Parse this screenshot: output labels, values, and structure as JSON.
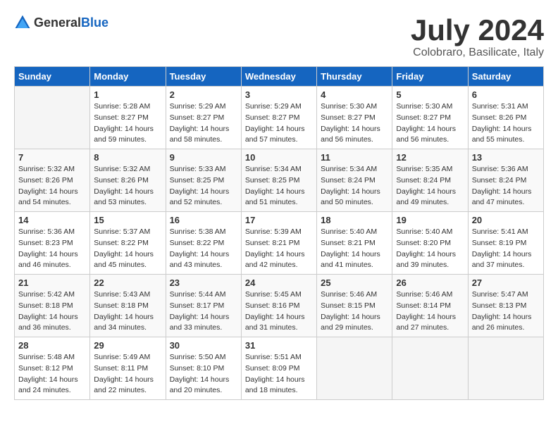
{
  "header": {
    "logo": {
      "text_general": "General",
      "text_blue": "Blue"
    },
    "title": "July 2024",
    "subtitle": "Colobraro, Basilicate, Italy"
  },
  "days_of_week": [
    "Sunday",
    "Monday",
    "Tuesday",
    "Wednesday",
    "Thursday",
    "Friday",
    "Saturday"
  ],
  "weeks": [
    [
      {
        "day": "",
        "info": ""
      },
      {
        "day": "1",
        "info": "Sunrise: 5:28 AM\nSunset: 8:27 PM\nDaylight: 14 hours\nand 59 minutes."
      },
      {
        "day": "2",
        "info": "Sunrise: 5:29 AM\nSunset: 8:27 PM\nDaylight: 14 hours\nand 58 minutes."
      },
      {
        "day": "3",
        "info": "Sunrise: 5:29 AM\nSunset: 8:27 PM\nDaylight: 14 hours\nand 57 minutes."
      },
      {
        "day": "4",
        "info": "Sunrise: 5:30 AM\nSunset: 8:27 PM\nDaylight: 14 hours\nand 56 minutes."
      },
      {
        "day": "5",
        "info": "Sunrise: 5:30 AM\nSunset: 8:27 PM\nDaylight: 14 hours\nand 56 minutes."
      },
      {
        "day": "6",
        "info": "Sunrise: 5:31 AM\nSunset: 8:26 PM\nDaylight: 14 hours\nand 55 minutes."
      }
    ],
    [
      {
        "day": "7",
        "info": "Sunrise: 5:32 AM\nSunset: 8:26 PM\nDaylight: 14 hours\nand 54 minutes."
      },
      {
        "day": "8",
        "info": "Sunrise: 5:32 AM\nSunset: 8:26 PM\nDaylight: 14 hours\nand 53 minutes."
      },
      {
        "day": "9",
        "info": "Sunrise: 5:33 AM\nSunset: 8:25 PM\nDaylight: 14 hours\nand 52 minutes."
      },
      {
        "day": "10",
        "info": "Sunrise: 5:34 AM\nSunset: 8:25 PM\nDaylight: 14 hours\nand 51 minutes."
      },
      {
        "day": "11",
        "info": "Sunrise: 5:34 AM\nSunset: 8:24 PM\nDaylight: 14 hours\nand 50 minutes."
      },
      {
        "day": "12",
        "info": "Sunrise: 5:35 AM\nSunset: 8:24 PM\nDaylight: 14 hours\nand 49 minutes."
      },
      {
        "day": "13",
        "info": "Sunrise: 5:36 AM\nSunset: 8:24 PM\nDaylight: 14 hours\nand 47 minutes."
      }
    ],
    [
      {
        "day": "14",
        "info": "Sunrise: 5:36 AM\nSunset: 8:23 PM\nDaylight: 14 hours\nand 46 minutes."
      },
      {
        "day": "15",
        "info": "Sunrise: 5:37 AM\nSunset: 8:22 PM\nDaylight: 14 hours\nand 45 minutes."
      },
      {
        "day": "16",
        "info": "Sunrise: 5:38 AM\nSunset: 8:22 PM\nDaylight: 14 hours\nand 43 minutes."
      },
      {
        "day": "17",
        "info": "Sunrise: 5:39 AM\nSunset: 8:21 PM\nDaylight: 14 hours\nand 42 minutes."
      },
      {
        "day": "18",
        "info": "Sunrise: 5:40 AM\nSunset: 8:21 PM\nDaylight: 14 hours\nand 41 minutes."
      },
      {
        "day": "19",
        "info": "Sunrise: 5:40 AM\nSunset: 8:20 PM\nDaylight: 14 hours\nand 39 minutes."
      },
      {
        "day": "20",
        "info": "Sunrise: 5:41 AM\nSunset: 8:19 PM\nDaylight: 14 hours\nand 37 minutes."
      }
    ],
    [
      {
        "day": "21",
        "info": "Sunrise: 5:42 AM\nSunset: 8:18 PM\nDaylight: 14 hours\nand 36 minutes."
      },
      {
        "day": "22",
        "info": "Sunrise: 5:43 AM\nSunset: 8:18 PM\nDaylight: 14 hours\nand 34 minutes."
      },
      {
        "day": "23",
        "info": "Sunrise: 5:44 AM\nSunset: 8:17 PM\nDaylight: 14 hours\nand 33 minutes."
      },
      {
        "day": "24",
        "info": "Sunrise: 5:45 AM\nSunset: 8:16 PM\nDaylight: 14 hours\nand 31 minutes."
      },
      {
        "day": "25",
        "info": "Sunrise: 5:46 AM\nSunset: 8:15 PM\nDaylight: 14 hours\nand 29 minutes."
      },
      {
        "day": "26",
        "info": "Sunrise: 5:46 AM\nSunset: 8:14 PM\nDaylight: 14 hours\nand 27 minutes."
      },
      {
        "day": "27",
        "info": "Sunrise: 5:47 AM\nSunset: 8:13 PM\nDaylight: 14 hours\nand 26 minutes."
      }
    ],
    [
      {
        "day": "28",
        "info": "Sunrise: 5:48 AM\nSunset: 8:12 PM\nDaylight: 14 hours\nand 24 minutes."
      },
      {
        "day": "29",
        "info": "Sunrise: 5:49 AM\nSunset: 8:11 PM\nDaylight: 14 hours\nand 22 minutes."
      },
      {
        "day": "30",
        "info": "Sunrise: 5:50 AM\nSunset: 8:10 PM\nDaylight: 14 hours\nand 20 minutes."
      },
      {
        "day": "31",
        "info": "Sunrise: 5:51 AM\nSunset: 8:09 PM\nDaylight: 14 hours\nand 18 minutes."
      },
      {
        "day": "",
        "info": ""
      },
      {
        "day": "",
        "info": ""
      },
      {
        "day": "",
        "info": ""
      }
    ]
  ]
}
